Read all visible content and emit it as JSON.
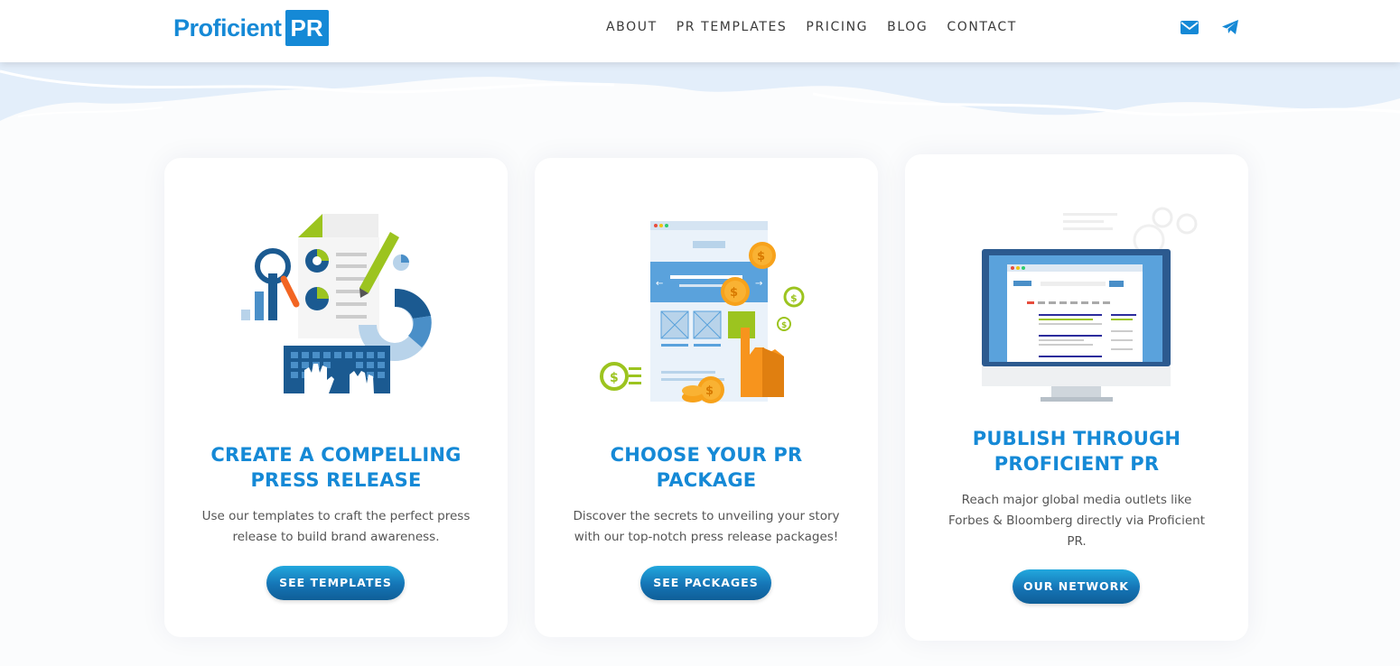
{
  "header": {
    "logo_text": "Proficient",
    "logo_badge": "PR",
    "nav": [
      "ABOUT",
      "PR TEMPLATES",
      "PRICING",
      "BLOG",
      "CONTACT"
    ],
    "icons": [
      "envelope-icon",
      "telegram-icon"
    ]
  },
  "colors": {
    "brand_blue": "#1589d6",
    "button_dark": "#0f5f98",
    "button_light": "#22a8de",
    "green": "#9cc41f",
    "orange": "#f7941d"
  },
  "cards": [
    {
      "title_line1": "CREATE A COMPELLING",
      "title_line2": "PRESS RELEASE",
      "desc_line1": "Use our templates to craft the perfect press",
      "desc_line2": "release to build brand awareness.",
      "button": "SEE TEMPLATES"
    },
    {
      "title_line1": "CHOOSE YOUR PR",
      "title_line2": "PACKAGE",
      "desc_line1": "Discover the secrets to unveiling your story",
      "desc_line2": "with our top-notch press release packages!",
      "button": "SEE PACKAGES"
    },
    {
      "title_line1": "PUBLISH THROUGH",
      "title_line2": "PROFICIENT PR",
      "desc_line1": "Reach major global media outlets like",
      "desc_line2": "Forbes & Bloomberg directly via Proficient",
      "desc_line3": "PR.",
      "button": "OUR NETWORK"
    }
  ]
}
